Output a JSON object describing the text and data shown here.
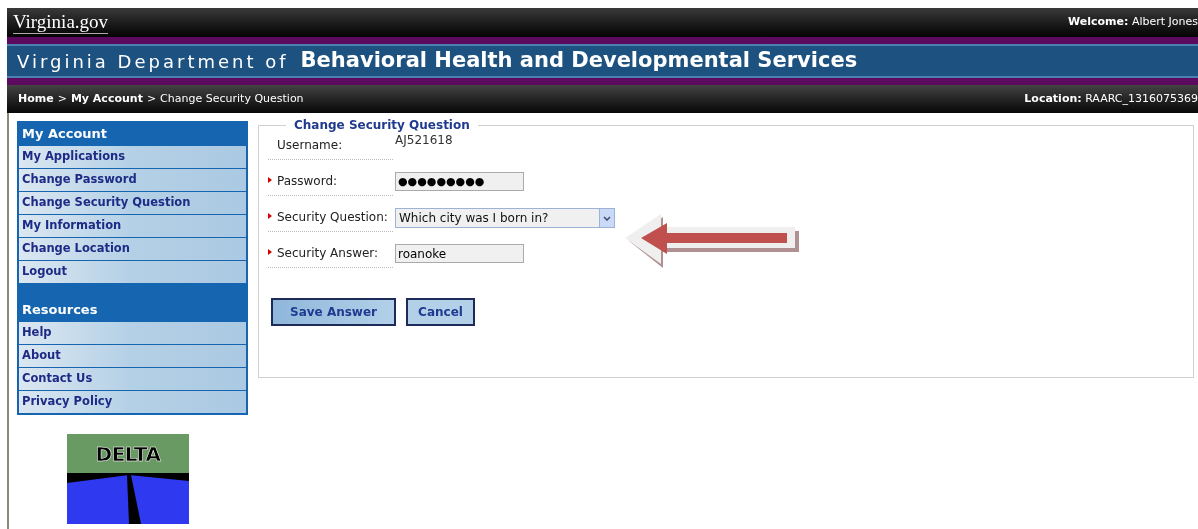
{
  "top_bar": {
    "logo": "Virginia.gov",
    "welcome_label": "Welcome:",
    "welcome_name": "Albert Jones"
  },
  "banner": {
    "prefix": "Virginia Department of",
    "title": "Behavioral Health and Developmental Services"
  },
  "breadcrumb": {
    "items": [
      {
        "label": "Home",
        "link": true
      },
      {
        "label": "My Account",
        "link": true
      },
      {
        "label": "Change Security Question",
        "link": false
      }
    ],
    "separator": ">",
    "location_label": "Location:",
    "location_value": "RAARC_1316075369"
  },
  "sidebar": {
    "sections": [
      {
        "title": "My Account",
        "items": [
          {
            "label": "My Applications"
          },
          {
            "label": "Change Password"
          },
          {
            "label": "Change Security Question"
          },
          {
            "label": "My Information"
          },
          {
            "label": "Change Location"
          },
          {
            "label": "Logout"
          }
        ]
      },
      {
        "title": "Resources",
        "items": [
          {
            "label": "Help"
          },
          {
            "label": "About"
          },
          {
            "label": "Contact Us"
          },
          {
            "label": "Privacy Policy"
          }
        ]
      }
    ],
    "logo": "DELTA"
  },
  "form": {
    "title": "Change Security Question",
    "fields": [
      {
        "kind": "static",
        "label": "Username:",
        "value": "AJ521618",
        "required": false
      },
      {
        "kind": "password",
        "label": "Password:",
        "value": "●●●●●●●●●",
        "required": true
      },
      {
        "kind": "select",
        "label": "Security Question:",
        "value": "Which city was I born in?",
        "required": true
      },
      {
        "kind": "input",
        "label": "Security Answer:",
        "value": "roanoke",
        "required": true
      }
    ],
    "buttons": [
      "Save Answer",
      "Cancel"
    ]
  }
}
